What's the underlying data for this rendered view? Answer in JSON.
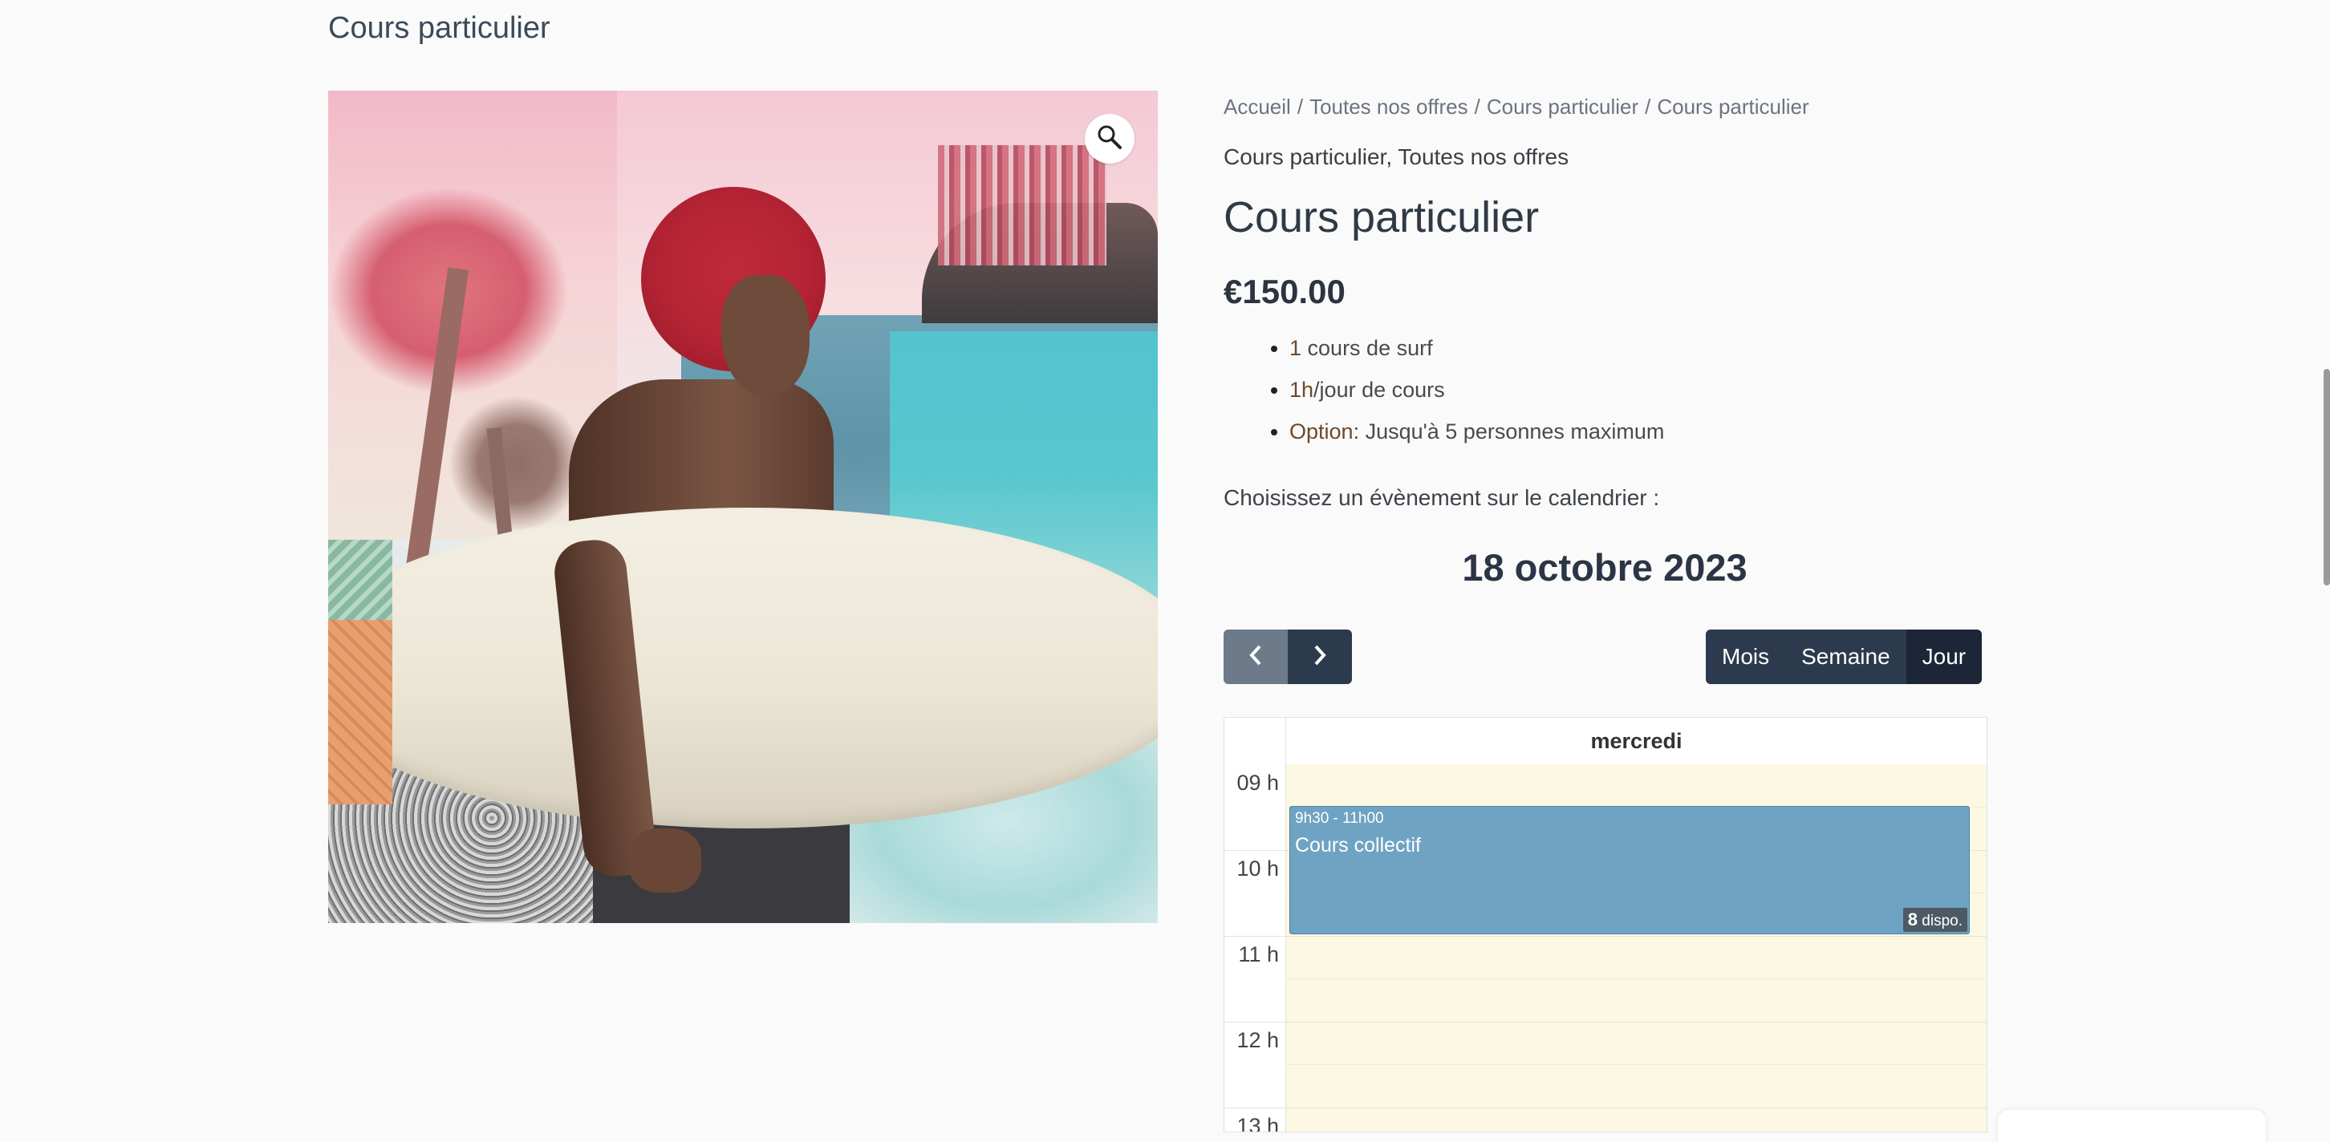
{
  "header": {
    "title": "Cours particulier"
  },
  "product": {
    "breadcrumb": [
      "Accueil",
      "Toutes nos offres",
      "Cours particulier",
      "Cours particulier"
    ],
    "categories": [
      "Cours particulier",
      "Toutes nos offres"
    ],
    "title": "Cours particulier",
    "price": "€150.00",
    "features": [
      {
        "highlight": "1",
        "text": " cours de surf"
      },
      {
        "highlight": "1h",
        "text": "/jour de cours"
      },
      {
        "highlight": "Option",
        "text": ": Jusqu'à 5 personnes maximum"
      }
    ],
    "choose_label": "Choisissez un évènement sur le calendrier :"
  },
  "calendar": {
    "date": "18 octobre 2023",
    "views": [
      "Mois",
      "Semaine",
      "Jour"
    ],
    "active_view": "Jour",
    "day_header": "mercredi",
    "hours": [
      "09 h",
      "10 h",
      "11 h",
      "12 h",
      "13 h"
    ],
    "event": {
      "time": "9h30 - 11h00",
      "title": "Cours collectif",
      "available_count": "8",
      "available_label": "dispo."
    }
  },
  "icons": {
    "zoom": "magnifier-icon",
    "prev": "chevron-left-icon",
    "next": "chevron-right-icon"
  },
  "colors": {
    "nav_dark": "#2c3a4e",
    "event": "#6fa3c3",
    "day_bg": "#fcf8e3"
  }
}
